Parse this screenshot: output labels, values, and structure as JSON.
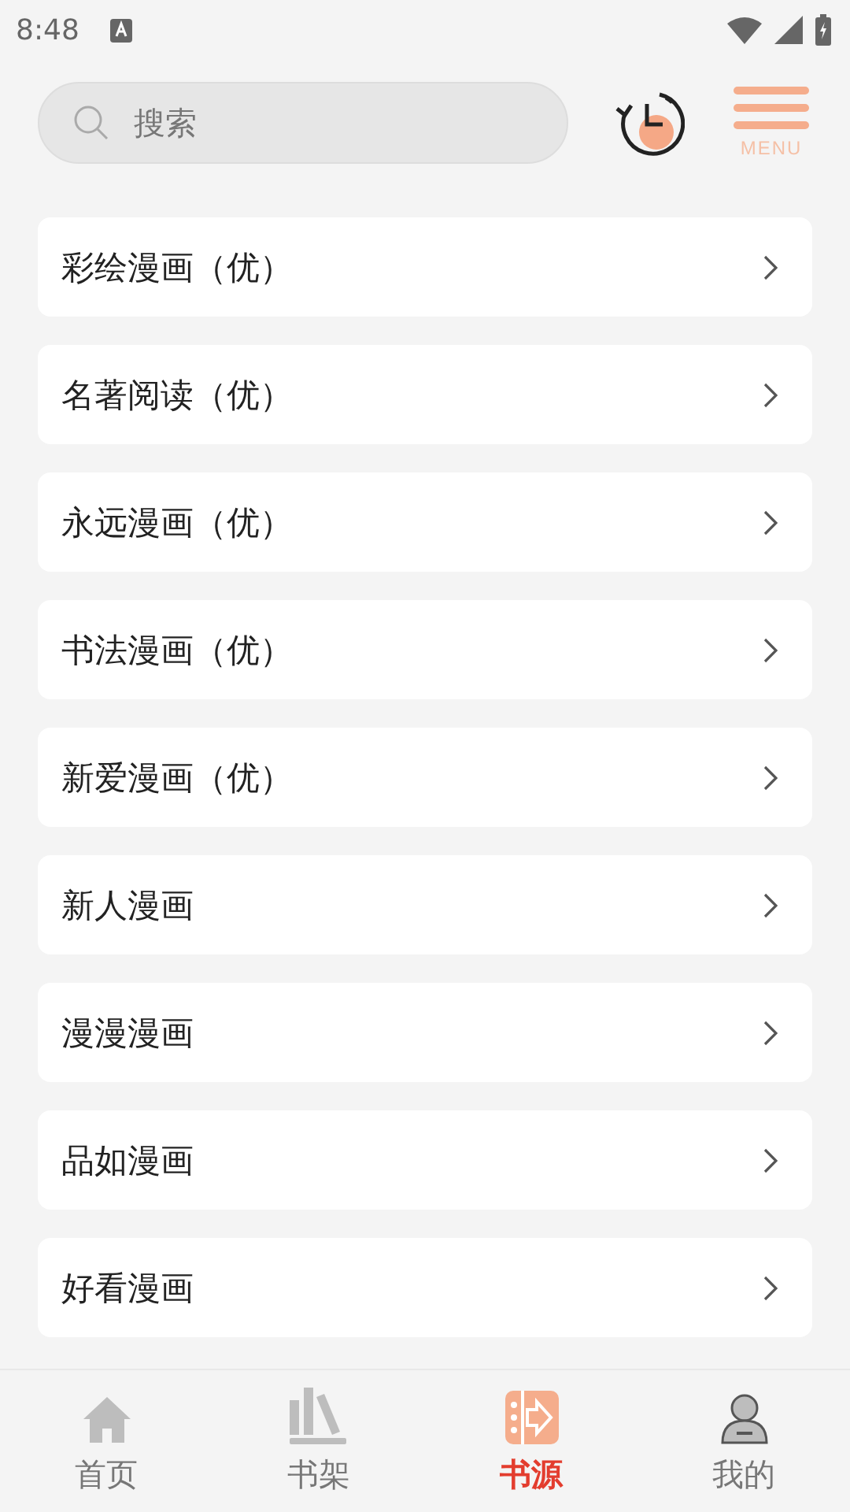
{
  "status_bar": {
    "time": "8:48"
  },
  "search": {
    "placeholder": "搜索"
  },
  "menu_button": {
    "label": "MENU"
  },
  "sources": [
    {
      "name": "彩绘漫画（优）"
    },
    {
      "name": "名著阅读（优）"
    },
    {
      "name": "永远漫画（优）"
    },
    {
      "name": "书法漫画（优）"
    },
    {
      "name": "新爱漫画（优）"
    },
    {
      "name": "新人漫画"
    },
    {
      "name": "漫漫漫画"
    },
    {
      "name": "品如漫画"
    },
    {
      "name": "好看漫画"
    }
  ],
  "tab_bar": [
    {
      "label": "首页",
      "kind": "home",
      "selected": false
    },
    {
      "label": "书架",
      "kind": "shelf",
      "selected": false
    },
    {
      "label": "书源",
      "kind": "source",
      "selected": true
    },
    {
      "label": "我的",
      "kind": "profile",
      "selected": false
    }
  ]
}
